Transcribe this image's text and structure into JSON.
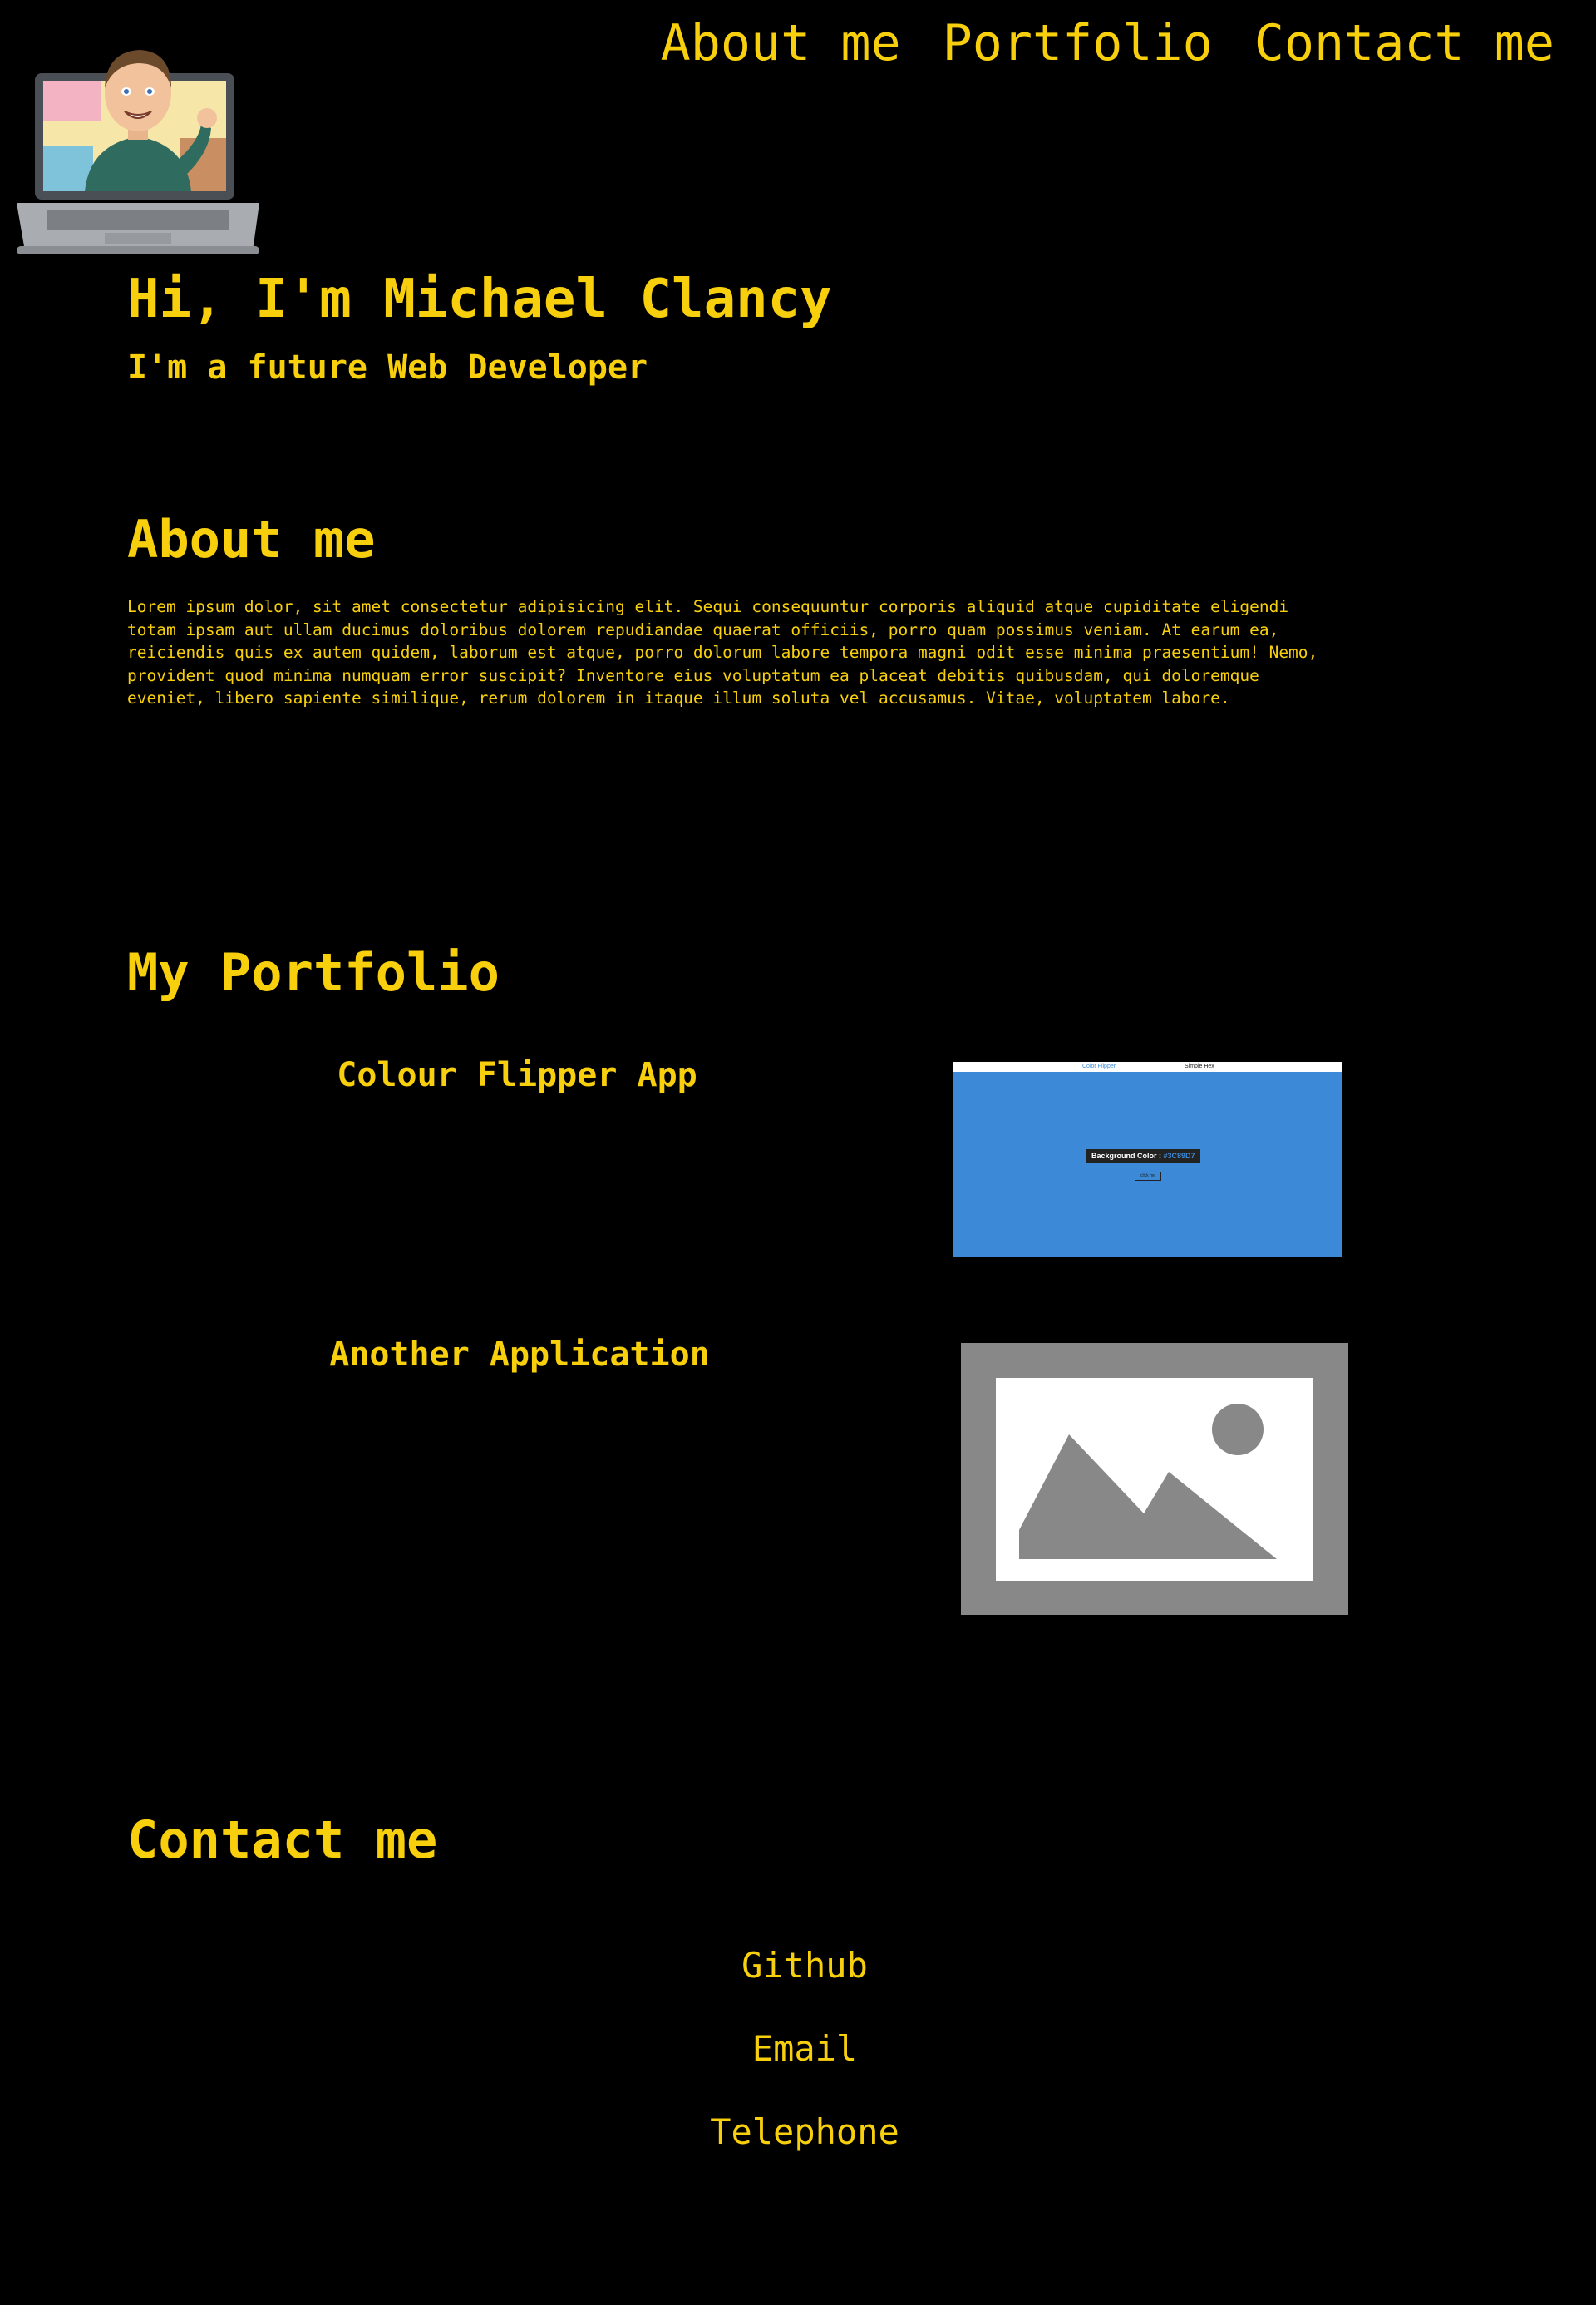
{
  "nav": {
    "items": [
      {
        "label": "About me"
      },
      {
        "label": "Portfolio"
      },
      {
        "label": "Contact me"
      }
    ]
  },
  "logo": {
    "icon": "avatar-laptop-icon"
  },
  "hero": {
    "title": "Hi, I'm Michael Clancy",
    "subtitle": "I'm a future Web Developer"
  },
  "about": {
    "heading": "About me",
    "text": "Lorem ipsum dolor, sit amet consectetur adipisicing elit. Sequi consequuntur corporis aliquid atque cupiditate eligendi totam ipsam aut ullam ducimus doloribus dolorem repudiandae quaerat officiis, porro quam possimus veniam. At earum ea, reiciendis quis ex autem quidem, laborum est atque, porro dolorum labore tempora magni odit esse minima praesentium! Nemo, provident quod minima numquam error suscipit? Inventore eius voluptatum ea placeat debitis quibusdam, qui doloremque eveniet, libero sapiente similique, rerum dolorem in itaque illum soluta vel accusamus. Vitae, voluptatem labore."
  },
  "portfolio": {
    "heading": "My Portfolio",
    "projects": [
      {
        "title": "Colour Flipper App",
        "thumbnail": {
          "nav_left": "Color Flipper",
          "nav_right": "Simple   Hex",
          "label": "Background Color : ",
          "hex": "#3C89D7",
          "button": "click me"
        }
      },
      {
        "title": "Another Application",
        "thumbnail": {
          "icon": "image-placeholder-icon"
        }
      }
    ]
  },
  "contact": {
    "heading": "Contact me",
    "links": [
      {
        "label": "Github"
      },
      {
        "label": "Email"
      },
      {
        "label": "Telephone"
      }
    ]
  },
  "colors": {
    "background": "#000000",
    "accent": "#f7cf0d",
    "thumb_blue": "#3c89d7",
    "placeholder_grey": "#888888"
  }
}
